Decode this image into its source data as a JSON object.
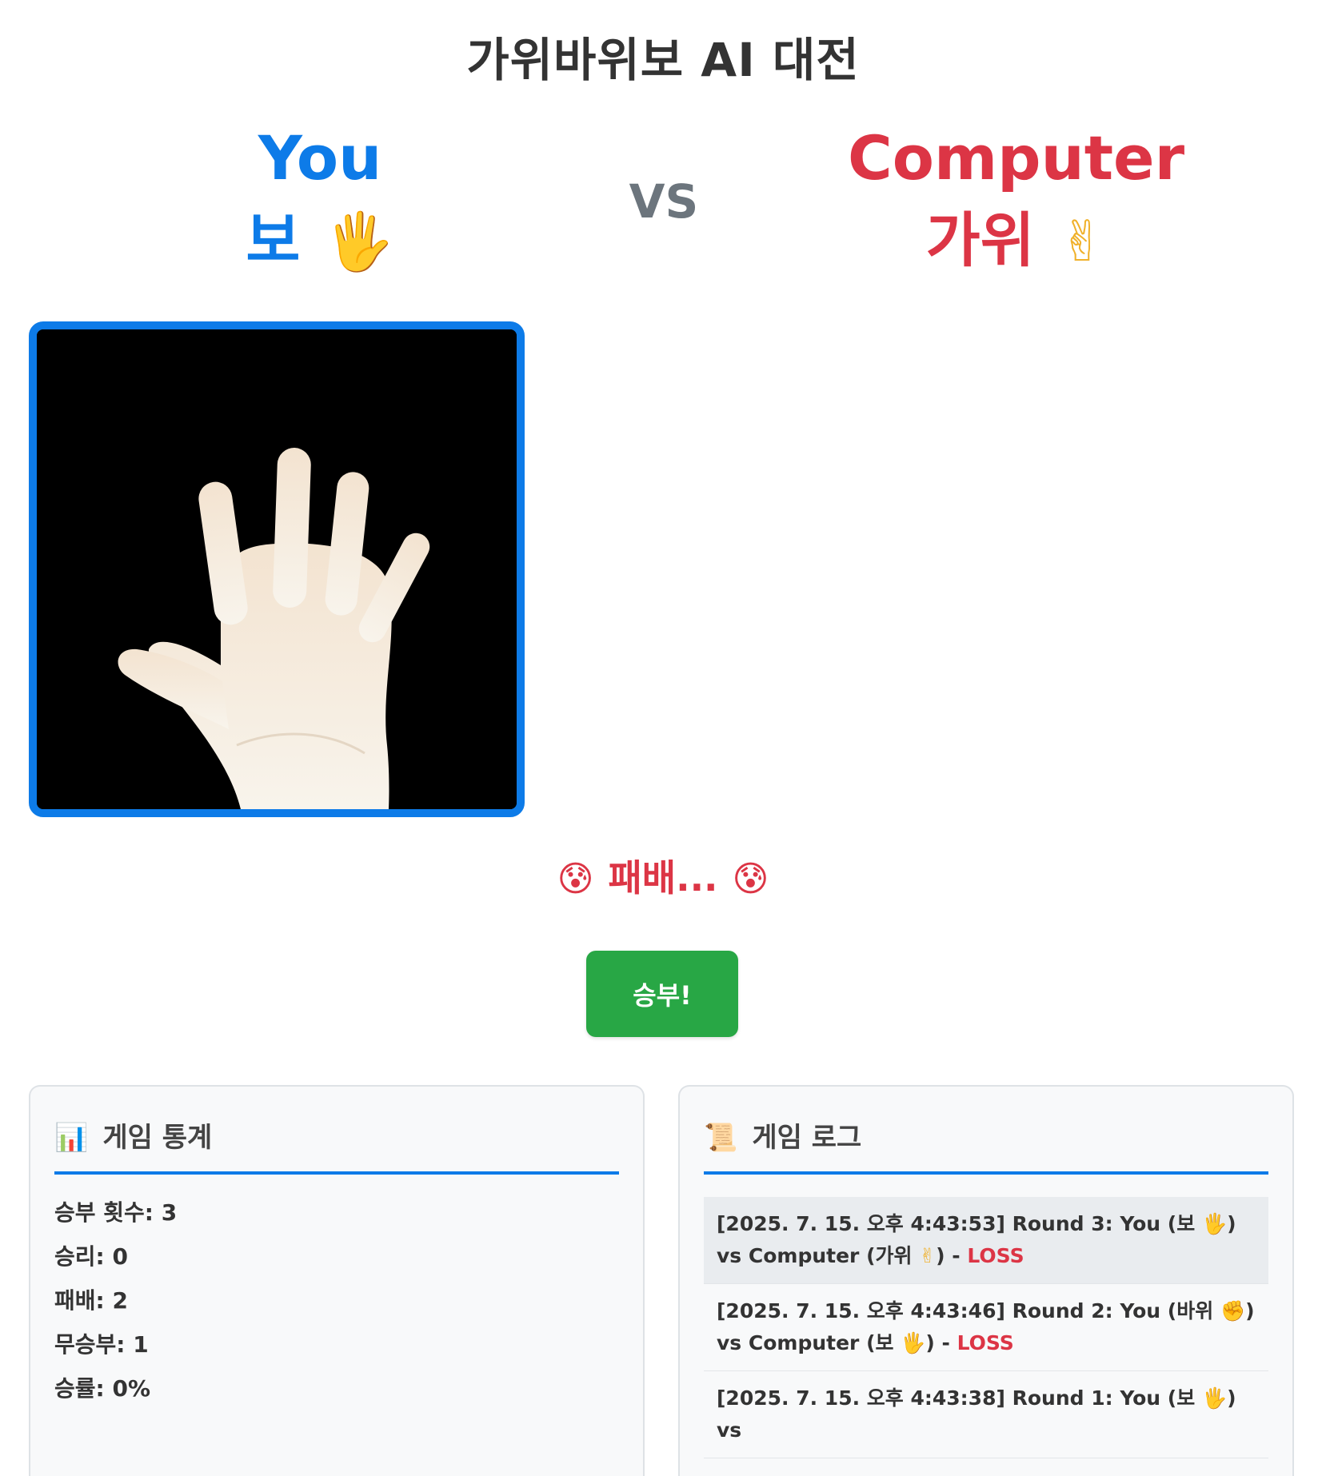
{
  "title": "가위바위보 AI 대전",
  "player": {
    "name": "You",
    "choice": "보",
    "choice_emoji": "🖐"
  },
  "vs": "VS",
  "computer": {
    "name": "Computer",
    "choice": "가위",
    "choice_emoji": "✌"
  },
  "webcam": {
    "icon": "open-hand-webcam-image"
  },
  "result": {
    "emoji_left": "😰",
    "text": "패배...",
    "emoji_right": "😰"
  },
  "play_button": "승부!",
  "stats": {
    "icon": "📊",
    "title": "게임 통계",
    "rows": [
      "승부 횟수: 3",
      "승리: 0",
      "패배: 2",
      "무승부: 1",
      "승률: 0%"
    ]
  },
  "log": {
    "icon": "📜",
    "title": "게임 로그",
    "entries": [
      {
        "line1": "[2025. 7. 15. 오후 4:43:53] Round 3: You (보 ",
        "emoji1": "🖐",
        "mid": ") vs Computer (가위 ",
        "emoji2": "✌",
        "tail": ") - ",
        "result": "LOSS"
      },
      {
        "line1": "[2025. 7. 15. 오후 4:43:46] Round 2: You (바위 ",
        "emoji1": "✊",
        "mid": ") vs Computer (보 ",
        "emoji2": "🖐",
        "tail": ") - ",
        "result": "LOSS"
      },
      {
        "line1": "[2025. 7. 15. 오후 4:43:38] Round 1: You (보 ",
        "emoji1": "🖐",
        "mid": ") vs",
        "emoji2": "",
        "tail": "",
        "result": ""
      }
    ]
  },
  "colors": {
    "player_blue": "#0d7be8",
    "computer_red": "#dc3545",
    "play_green": "#28a745",
    "vs_gray": "#6c757d"
  }
}
